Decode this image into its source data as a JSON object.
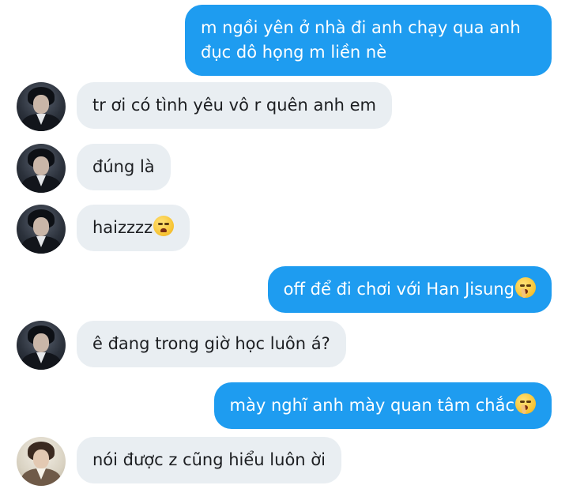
{
  "messages": [
    {
      "from": "me",
      "text": "m ngồi yên ở nhà đi anh chạy qua anh",
      "text2": "đục dô họng m liền nè"
    },
    {
      "from": "friend",
      "text": "tr ơi có tình yêu vô r quên anh em"
    },
    {
      "from": "friend",
      "text": "đúng là"
    },
    {
      "from": "friend",
      "text": "haizzzz",
      "emoji": "weary-face-icon"
    },
    {
      "from": "me",
      "text": "off để đi chơi với Han Jisung",
      "emoji": "shushing-face-icon"
    },
    {
      "from": "friend",
      "text": "ê đang trong giờ học luôn á?"
    },
    {
      "from": "me",
      "text": "mày nghĩ anh mày quan tâm chắc",
      "emoji": "shushing-face-icon"
    },
    {
      "from": "friend",
      "text": "nói được z cũng hiểu luôn ời"
    }
  ],
  "colors": {
    "outgoing_bubble": "#1e9cf0",
    "incoming_bubble": "#e9eef2",
    "background": "#ffffff"
  }
}
